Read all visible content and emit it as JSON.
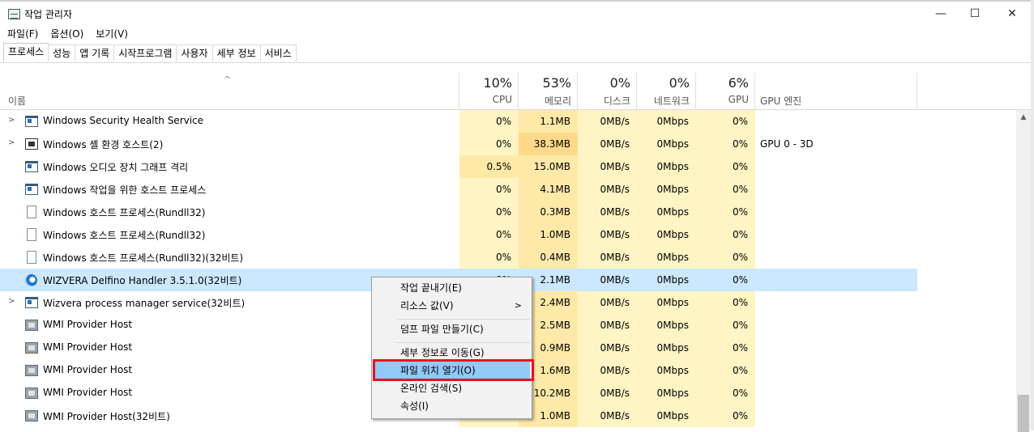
{
  "window": {
    "title": "작업 관리자",
    "controls": {
      "minimize": "—",
      "maximize": "☐",
      "close": "✕"
    }
  },
  "menu": [
    "파일(F)",
    "옵션(O)",
    "보기(V)"
  ],
  "tabs": [
    "프로세스",
    "성능",
    "앱 기록",
    "시작프로그램",
    "사용자",
    "세부 정보",
    "서비스"
  ],
  "active_tab": "프로세스",
  "header": {
    "sort_indicator": "^",
    "name_label": "이름",
    "columns": [
      {
        "pct": "10%",
        "label": "CPU"
      },
      {
        "pct": "53%",
        "label": "메모리"
      },
      {
        "pct": "0%",
        "label": "디스크"
      },
      {
        "pct": "0%",
        "label": "네트워크"
      },
      {
        "pct": "6%",
        "label": "GPU"
      }
    ],
    "gpu_engine_label": "GPU 엔진"
  },
  "rows": [
    {
      "name": "Windows Security Health Service",
      "icon": "window-icon",
      "expand": ">",
      "cpu": "0%",
      "mem": "1.1MB",
      "disk": "0MB/s",
      "net": "0Mbps",
      "gpu": "0%",
      "gpu_engine": ""
    },
    {
      "name": "Windows 셸 환경 호스트(2)",
      "icon": "shell-icon",
      "expand": ">",
      "cpu": "0%",
      "mem": "38.3MB",
      "disk": "0MB/s",
      "net": "0Mbps",
      "gpu": "0%",
      "gpu_engine": "GPU 0 - 3D"
    },
    {
      "name": "Windows 오디오 장치 그래프 격리",
      "icon": "window-icon",
      "expand": "",
      "cpu": "0.5%",
      "mem": "15.0MB",
      "disk": "0MB/s",
      "net": "0Mbps",
      "gpu": "0%",
      "gpu_engine": ""
    },
    {
      "name": "Windows 작업을 위한 호스트 프로세스",
      "icon": "window-icon",
      "expand": "",
      "cpu": "0%",
      "mem": "4.1MB",
      "disk": "0MB/s",
      "net": "0Mbps",
      "gpu": "0%",
      "gpu_engine": ""
    },
    {
      "name": "Windows 호스트 프로세스(Rundll32)",
      "icon": "document-icon",
      "expand": "",
      "cpu": "0%",
      "mem": "0.3MB",
      "disk": "0MB/s",
      "net": "0Mbps",
      "gpu": "0%",
      "gpu_engine": ""
    },
    {
      "name": "Windows 호스트 프로세스(Rundll32)",
      "icon": "document-icon",
      "expand": "",
      "cpu": "0%",
      "mem": "1.0MB",
      "disk": "0MB/s",
      "net": "0Mbps",
      "gpu": "0%",
      "gpu_engine": ""
    },
    {
      "name": "Windows 호스트 프로세스(Rundll32)(32비트)",
      "icon": "document-icon",
      "expand": "",
      "cpu": "0%",
      "mem": "0.4MB",
      "disk": "0MB/s",
      "net": "0Mbps",
      "gpu": "0%",
      "gpu_engine": ""
    },
    {
      "name": "WIZVERA Delfino Handler 3.5.1.0(32비트)",
      "icon": "delfino-icon",
      "expand": "",
      "cpu": "0%",
      "mem": "2.1MB",
      "disk": "0MB/s",
      "net": "0Mbps",
      "gpu": "0%",
      "gpu_engine": "",
      "selected": true
    },
    {
      "name": "Wizvera process manager service(32비트)",
      "icon": "window-icon",
      "expand": ">",
      "cpu": "",
      "mem": "2.4MB",
      "disk": "0MB/s",
      "net": "0Mbps",
      "gpu": "0%",
      "gpu_engine": ""
    },
    {
      "name": "WMI Provider Host",
      "icon": "wmi-icon",
      "expand": "",
      "cpu": "",
      "mem": "2.5MB",
      "disk": "0MB/s",
      "net": "0Mbps",
      "gpu": "0%",
      "gpu_engine": ""
    },
    {
      "name": "WMI Provider Host",
      "icon": "wmi-icon",
      "expand": "",
      "cpu": "",
      "mem": "0.9MB",
      "disk": "0MB/s",
      "net": "0Mbps",
      "gpu": "0%",
      "gpu_engine": ""
    },
    {
      "name": "WMI Provider Host",
      "icon": "wmi-icon",
      "expand": "",
      "cpu": "",
      "mem": "1.6MB",
      "disk": "0MB/s",
      "net": "0Mbps",
      "gpu": "0%",
      "gpu_engine": ""
    },
    {
      "name": "WMI Provider Host",
      "icon": "wmi-icon",
      "expand": "",
      "cpu": "",
      "mem": "10.2MB",
      "disk": "0MB/s",
      "net": "0Mbps",
      "gpu": "0%",
      "gpu_engine": ""
    },
    {
      "name": "WMI Provider Host(32비트)",
      "icon": "wmi-icon",
      "expand": "",
      "cpu": "",
      "mem": "1.0MB",
      "disk": "0MB/s",
      "net": "0Mbps",
      "gpu": "0%",
      "gpu_engine": ""
    }
  ],
  "context_menu": {
    "items": [
      {
        "label": "작업 끝내기(E)"
      },
      {
        "label": "리소스 값(V)",
        "submenu_arrow": ">"
      },
      {
        "label": "덤프 파일 만들기(C)"
      },
      {
        "label": "세부 정보로 이동(G)"
      },
      {
        "label": "파일 위치 열기(O)",
        "highlighted": true
      },
      {
        "label": "온라인 검색(S)"
      },
      {
        "label": "속성(I)"
      }
    ]
  },
  "colors": {
    "selection": "#cce8ff",
    "cell_fill": "#fff4c4",
    "mem_fill": "#ffe9a8",
    "menu_highlight": "#91c9f7",
    "annotation_box": "#e81123"
  }
}
